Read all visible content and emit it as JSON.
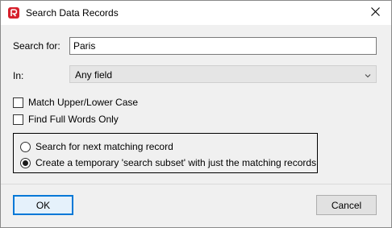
{
  "window": {
    "title": "Search Data Records",
    "icon": "app-logo-icon",
    "close_icon": "close-icon"
  },
  "search": {
    "label": "Search for:",
    "value": "Paris"
  },
  "field": {
    "label": "In:",
    "selected": "Any field"
  },
  "options": {
    "match_case": {
      "label": "Match Upper/Lower Case",
      "checked": false
    },
    "full_words": {
      "label": "Find Full Words Only",
      "checked": false
    }
  },
  "mode": {
    "next": {
      "label": "Search for next matching record",
      "selected": false
    },
    "subset": {
      "label": "Create a temporary 'search subset' with just the matching records",
      "selected": true
    }
  },
  "buttons": {
    "ok": "OK",
    "cancel": "Cancel"
  },
  "colors": {
    "accent": "#0078d7",
    "logo": "#d6202c"
  }
}
